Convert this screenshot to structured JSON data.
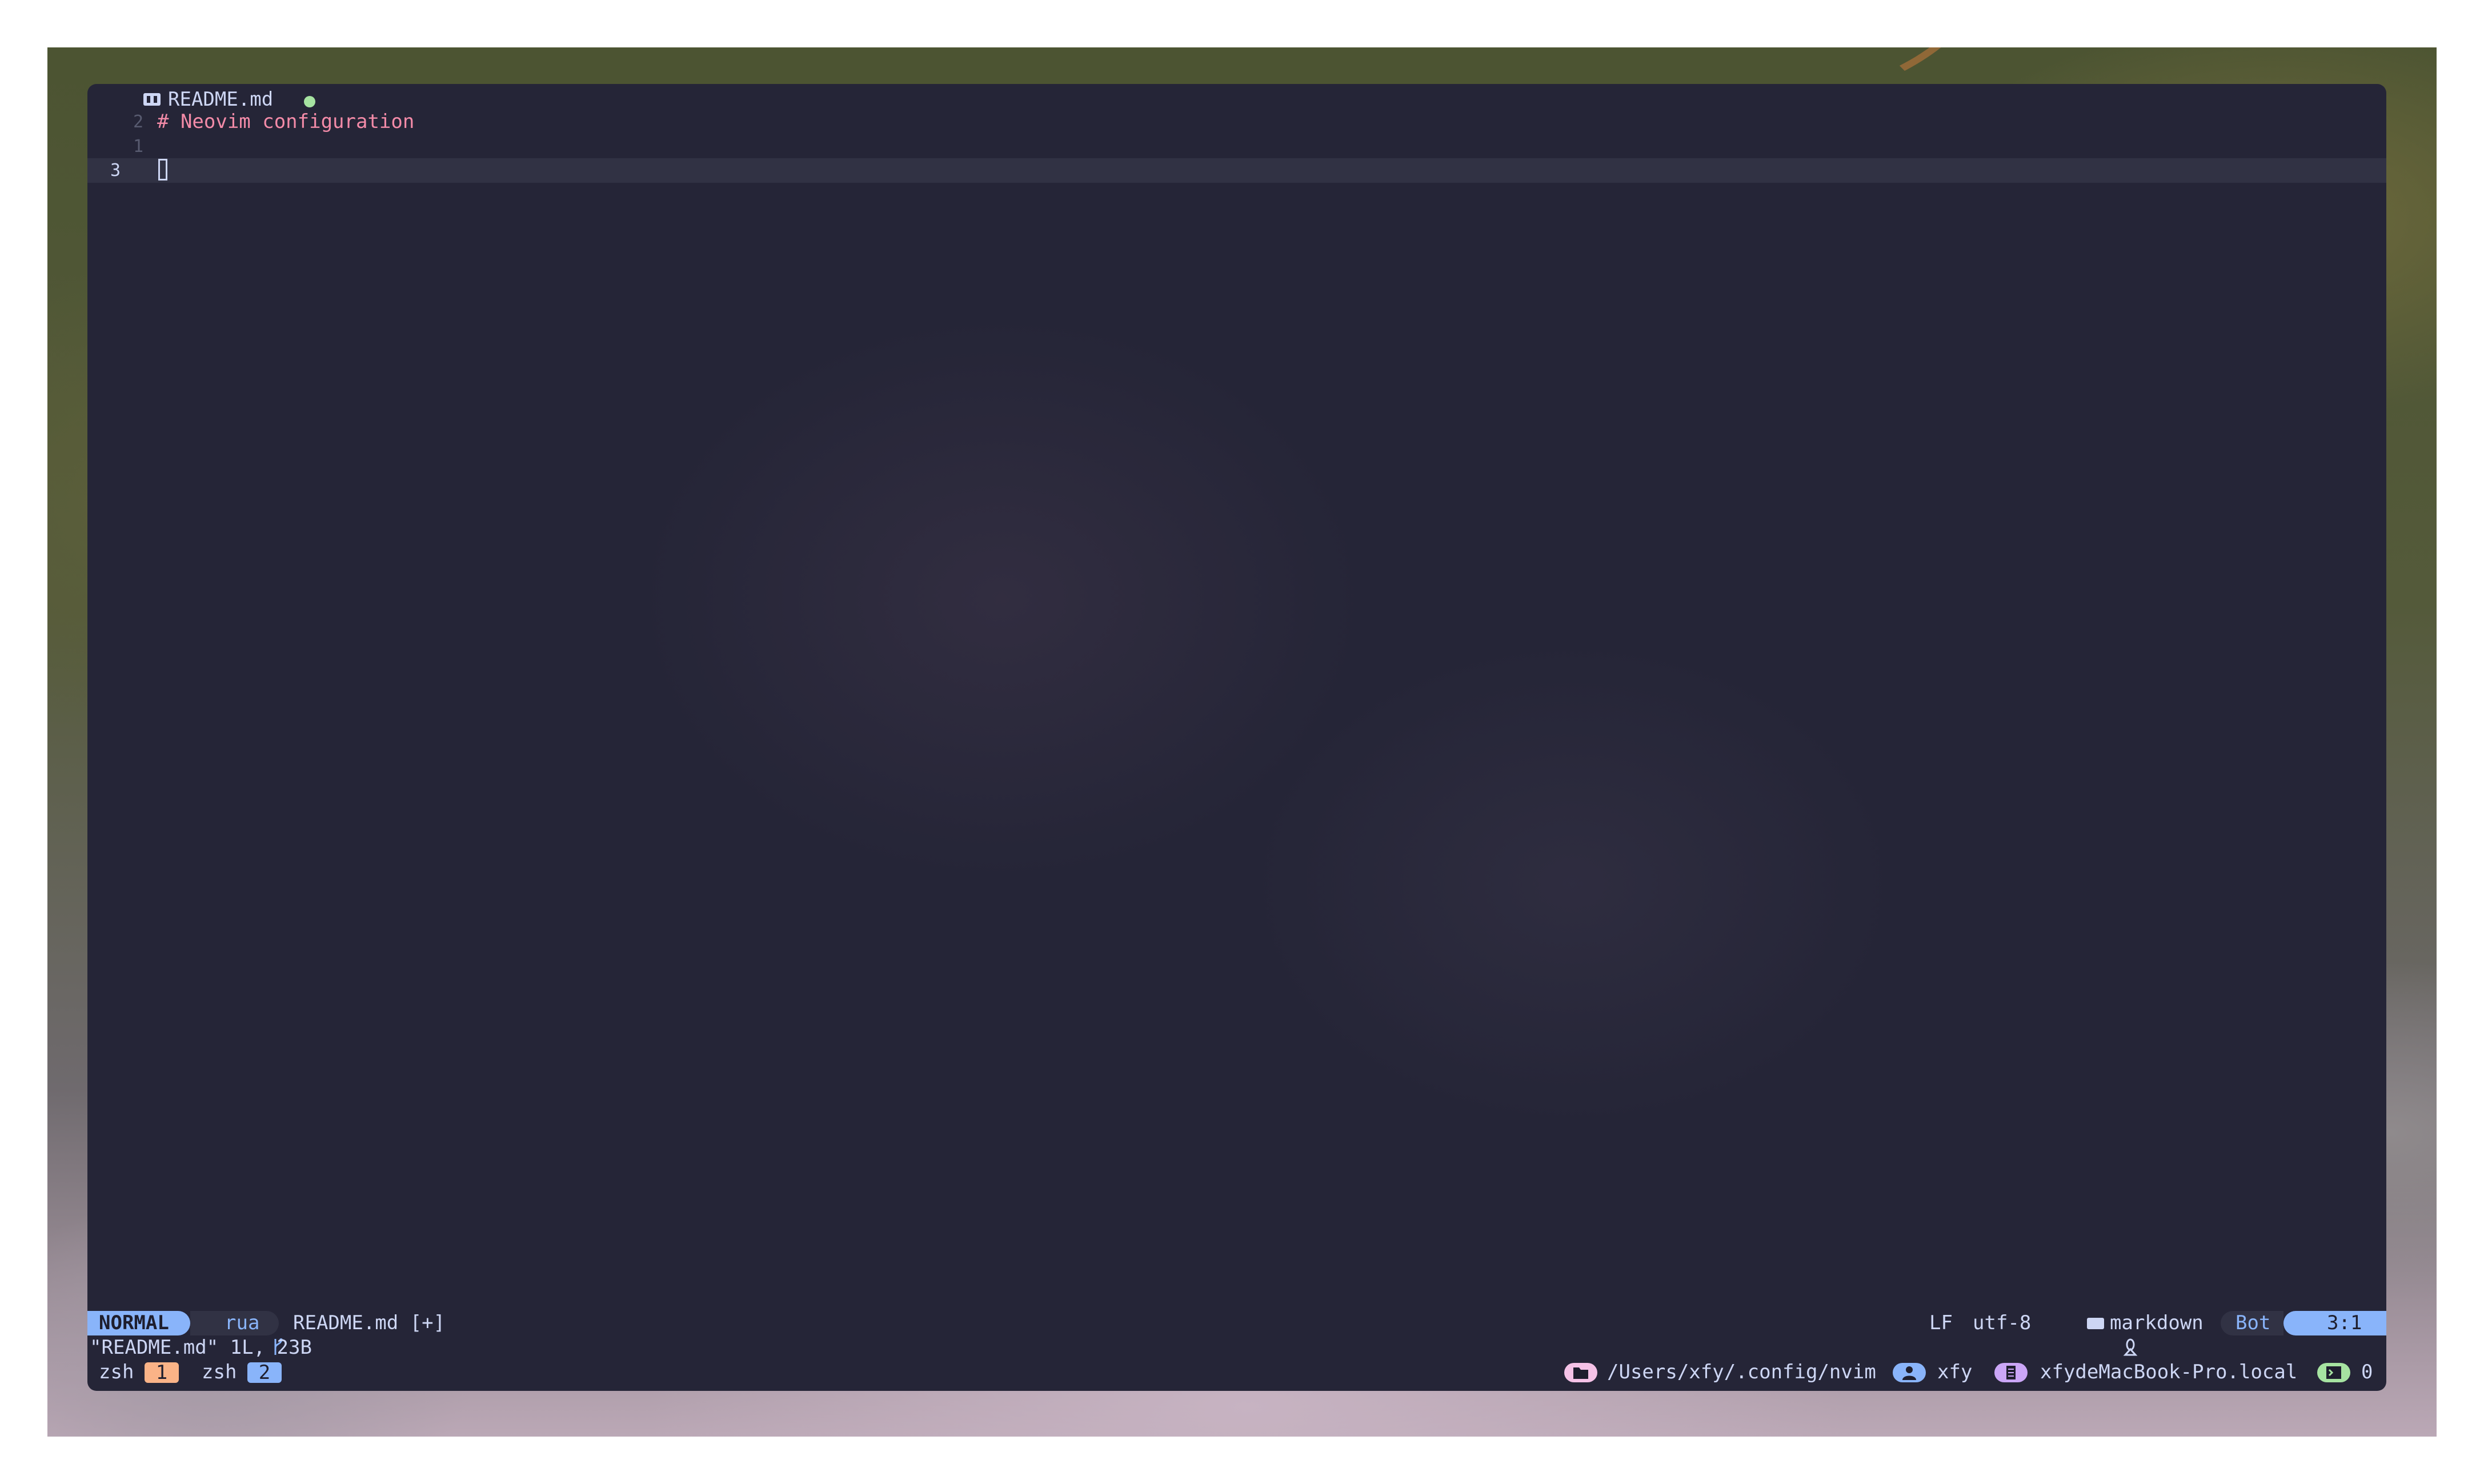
{
  "tabline": {
    "file_name": "README.md",
    "modified_dot_color": "#a6e3a1",
    "icon": "markdown-icon"
  },
  "buffer": {
    "lines": [
      {
        "number": "2",
        "text": "# Neovim configuration"
      },
      {
        "number": "1",
        "text": ""
      },
      {
        "number": "3",
        "text": ""
      }
    ]
  },
  "statusline": {
    "mode": "NORMAL",
    "branch_icon": "git-branch-icon",
    "branch": "rua",
    "file": "README.md [+]",
    "line_ending": "LF",
    "encoding": "utf-8",
    "os_icon": "linux-icon",
    "filetype_icon": "markdown-icon",
    "filetype": "markdown",
    "scroll": "Bot",
    "position": "3:1"
  },
  "message": "\"README.md\" 1L, 23B",
  "tmux": {
    "windows": [
      {
        "name": "zsh",
        "index": "1",
        "color": "#fab387"
      },
      {
        "name": "zsh",
        "index": "2",
        "color": "#89b4fa"
      }
    ],
    "path_icon": "folder-icon",
    "path": "/Users/xfy/.config/nvim",
    "user_icon": "user-icon",
    "user": "xfy",
    "host_icon": "host-icon",
    "host": "xfydeMacBook-Pro.local",
    "session_icon": "terminal-icon",
    "session": "0"
  },
  "colors": {
    "background": "#252537",
    "cursorline": "#313244",
    "text": "#cdd6f4",
    "heading": "#f38ba8",
    "accent_blue": "#89b4fa",
    "accent_pink": "#f5c2e7",
    "accent_green": "#a6e3a1"
  }
}
